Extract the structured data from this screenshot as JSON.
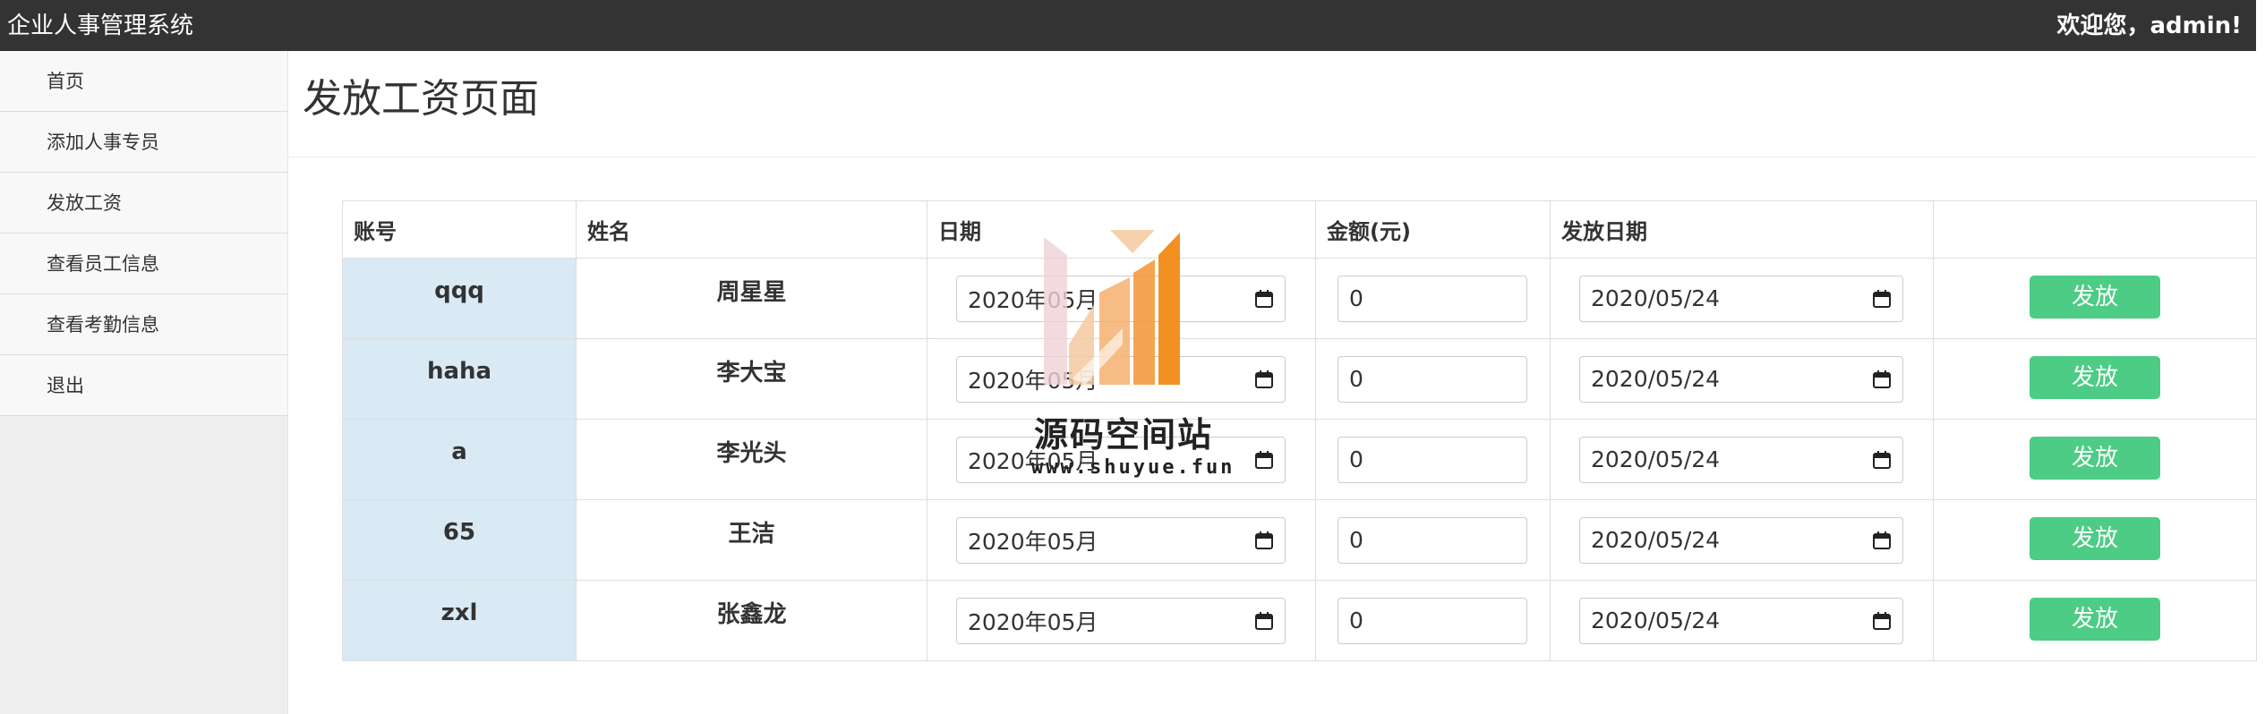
{
  "app": {
    "title": "企业人事管理系统",
    "welcome": "欢迎您，admin!"
  },
  "sidebar": {
    "items": [
      {
        "label": "首页"
      },
      {
        "label": "添加人事专员"
      },
      {
        "label": "发放工资"
      },
      {
        "label": "查看员工信息"
      },
      {
        "label": "查看考勤信息"
      },
      {
        "label": "退出"
      }
    ]
  },
  "page": {
    "title": "发放工资页面"
  },
  "table": {
    "headers": {
      "account": "账号",
      "name": "姓名",
      "date": "日期",
      "amount": "金额(元)",
      "pay_date": "发放日期",
      "action": ""
    },
    "rows": [
      {
        "account": "qqq",
        "name": "周星星",
        "date": "2020年05月",
        "amount": "0",
        "pay_date": "2020/05/24",
        "button": "发放"
      },
      {
        "account": "haha",
        "name": "李大宝",
        "date": "2020年05月",
        "amount": "0",
        "pay_date": "2020/05/24",
        "button": "发放"
      },
      {
        "account": "a",
        "name": "李光头",
        "date": "2020年05月",
        "amount": "0",
        "pay_date": "2020/05/24",
        "button": "发放"
      },
      {
        "account": "65",
        "name": "王洁",
        "date": "2020年05月",
        "amount": "0",
        "pay_date": "2020/05/24",
        "button": "发放"
      },
      {
        "account": "zxl",
        "name": "张鑫龙",
        "date": "2020年05月",
        "amount": "0",
        "pay_date": "2020/05/24",
        "button": "发放"
      }
    ]
  },
  "watermark": {
    "text": "源码空间站",
    "url": "www.shuyue.fun"
  },
  "colors": {
    "topbar": "#333333",
    "account_cell": "#d9eaf5",
    "button": "#4ccc84"
  }
}
